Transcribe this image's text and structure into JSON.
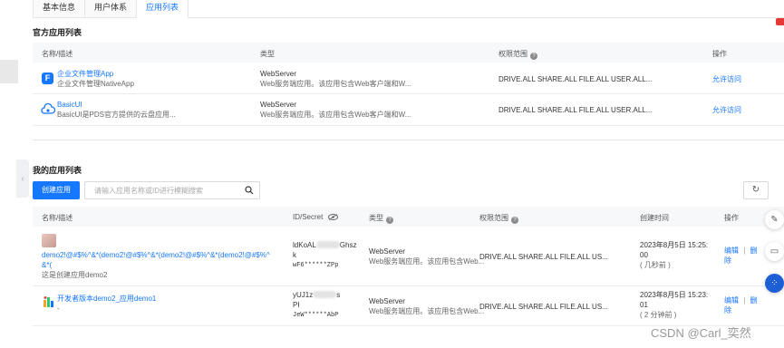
{
  "tabs": [
    {
      "label": "基本信息",
      "active": false
    },
    {
      "label": "用户体系",
      "active": false
    },
    {
      "label": "应用列表",
      "active": true
    }
  ],
  "official": {
    "title": "官方应用列表",
    "headers": {
      "name": "名称/描述",
      "type": "类型",
      "scope": "权限范围",
      "action": "操作"
    },
    "rows": [
      {
        "icon": "file-manager-app-icon",
        "name": "企业文件管理App",
        "desc": "企业文件管理NativeApp",
        "type": "WebServer",
        "type_desc": "Web服务端应用。该应用包含Web客户端和W...",
        "scope": "DRIVE.ALL SHARE.ALL FILE.ALL USER.ALL...",
        "action": "允许访问"
      },
      {
        "icon": "cloud-app-icon",
        "name": "BasicUI",
        "desc": "BasicUI是PDS官方提供的云盘应用...",
        "type": "WebServer",
        "type_desc": "Web服务端应用。该应用包含Web客户端和W...",
        "scope": "DRIVE.ALL SHARE.ALL FILE.ALL USER.ALL...",
        "action": "允许访问"
      }
    ]
  },
  "mine": {
    "title": "我的应用列表",
    "create_label": "创建应用",
    "search_placeholder": "请输入应用名称或ID进行模糊搜索",
    "headers": {
      "name": "名称/描述",
      "secret": "ID/Secret",
      "type": "类型",
      "scope": "权限范围",
      "created": "创建时间",
      "action": "操作"
    },
    "rows": [
      {
        "name_lines": [
          "demo2!@#$%^&*(demo2!@#$%^&*(demo2!@#$%^&*(demo2!@#$%^",
          "&*("
        ],
        "desc": "这是创建应用demo2",
        "id_parts": [
          "ldKoAL",
          "Ghsz",
          "k"
        ],
        "secret": "wF6******ZPp",
        "type": "WebServer",
        "type_desc": "Web服务端应用。该应用包含Web...",
        "scope": "DRIVE.ALL  SHARE.ALL  FILE.ALL  US...",
        "created": [
          "2023年8月5日 15:25:",
          "00",
          "( 几秒前 )"
        ],
        "edit": "编辑",
        "sep": "|",
        "delete": "删",
        "delete2": "除"
      },
      {
        "name_lines": [
          "开发者版本demo2_应用demo1"
        ],
        "desc": "-",
        "id_parts": [
          "yUJ1z",
          "s",
          "PI"
        ],
        "secret": "JeW******AbP",
        "type": "WebServer",
        "type_desc": "Web服务端应用。该应用包含Web...",
        "scope": "DRIVE.ALL  SHARE.ALL  FILE.ALL  US...",
        "created": [
          "2023年8月5日 15:23:",
          "01",
          "( 2 分钟前 )"
        ],
        "edit": "编辑",
        "sep": "|",
        "delete": "删",
        "delete2": "除"
      }
    ]
  },
  "watermark": "CSDN @Carl_奕然",
  "colors": {
    "accent": "#1677ff",
    "float_blue": "#1f5fd6"
  }
}
